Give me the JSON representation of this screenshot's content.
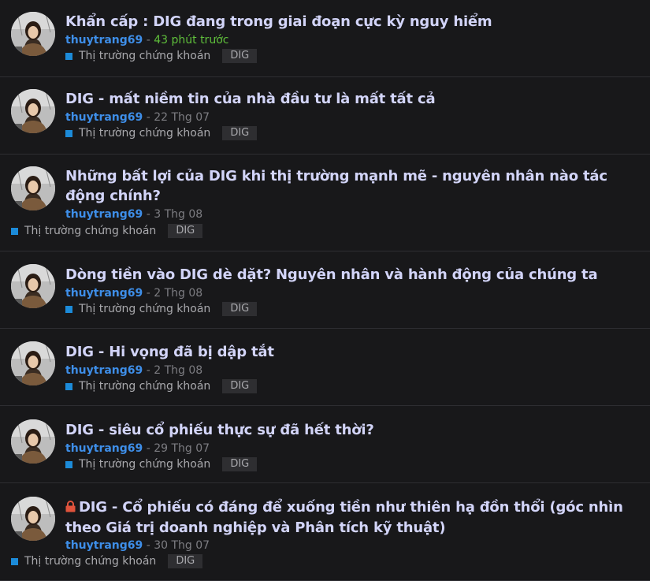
{
  "topics": [
    {
      "title": "Khẩn cấp : DIG đang trong giai đoạn cực kỳ nguy hiểm",
      "author": "thuytrang69",
      "separator": " - ",
      "date": "43 phút trước",
      "category": "Thị trường chứng khoán",
      "tag": "DIG",
      "locked": false,
      "recent": true
    },
    {
      "title": "DIG - mất niềm tin của nhà đầu tư là mất tất cả",
      "author": "thuytrang69",
      "separator": " - ",
      "date": "22 Thg 07",
      "category": "Thị trường chứng khoán",
      "tag": "DIG",
      "locked": false,
      "recent": false
    },
    {
      "title": "Những bất lợi của DIG khi thị trường mạnh mẽ - nguyên nhân nào tác động chính?",
      "author": "thuytrang69",
      "separator": " - ",
      "date": "3 Thg 08",
      "category": "Thị trường chứng khoán",
      "tag": "DIG",
      "locked": false,
      "recent": false
    },
    {
      "title": "Dòng tiền vào DIG dè dặt? Nguyên nhân và hành động của chúng ta",
      "author": "thuytrang69",
      "separator": " - ",
      "date": "2 Thg 08",
      "category": "Thị trường chứng khoán",
      "tag": "DIG",
      "locked": false,
      "recent": false
    },
    {
      "title": "DIG - Hi vọng đã bị dập tắt",
      "author": "thuytrang69",
      "separator": " - ",
      "date": "2 Thg 08",
      "category": "Thị trường chứng khoán",
      "tag": "DIG",
      "locked": false,
      "recent": false
    },
    {
      "title": "DIG - siêu cổ phiếu thực sự đã hết thời?",
      "author": "thuytrang69",
      "separator": " - ",
      "date": "29 Thg 07",
      "category": "Thị trường chứng khoán",
      "tag": "DIG",
      "locked": false,
      "recent": false
    },
    {
      "title": "DIG - Cổ phiếu có đáng để xuống tiền như thiên hạ đồn thổi (góc nhìn theo Giá trị doanh nghiệp và Phân tích kỹ thuật)",
      "author": "thuytrang69",
      "separator": " - ",
      "date": "30 Thg 07",
      "category": "Thị trường chứng khoán",
      "tag": "DIG",
      "locked": true,
      "recent": false
    }
  ],
  "colors": {
    "background": "#18181a",
    "title": "#d2d4f8",
    "author": "#3e8ee8",
    "recent_date": "#5fbf3b",
    "category_square": "#1c8bd9",
    "lock": "#e0533c"
  },
  "icons": {
    "lock": "lock-icon",
    "category": "category-square-icon"
  }
}
